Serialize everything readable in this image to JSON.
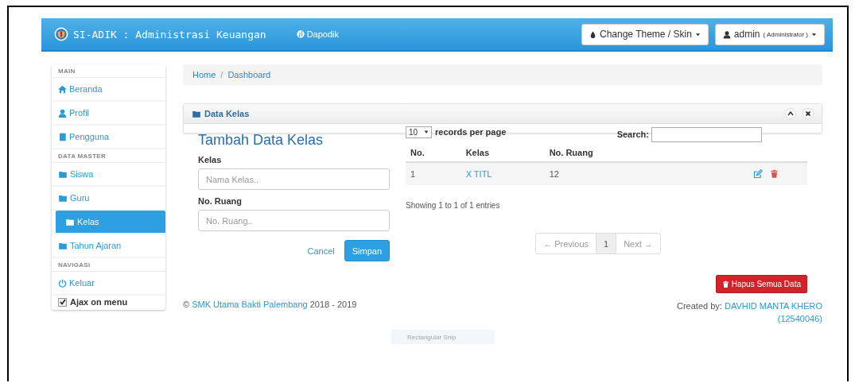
{
  "navbar": {
    "brand": "SI-ADIK : Administrasi Keuangan",
    "link": "Dapodik",
    "theme_button": "Change Theme / Skin",
    "user_button": {
      "name": "admin",
      "role": "( Administrator )"
    }
  },
  "sidebar": {
    "items": [
      {
        "kind": "header",
        "label": "MAIN"
      },
      {
        "kind": "link",
        "label": "Beranda",
        "selected": false
      },
      {
        "kind": "link",
        "label": "Profil",
        "selected": false
      },
      {
        "kind": "link",
        "label": "Pengguna",
        "selected": false
      },
      {
        "kind": "header",
        "label": "DATA MASTER"
      },
      {
        "kind": "link",
        "label": "Siswa",
        "selected": false
      },
      {
        "kind": "link",
        "label": "Guru",
        "selected": false
      },
      {
        "kind": "link",
        "label": "Kelas",
        "selected": true
      },
      {
        "kind": "link",
        "label": "Tahun Ajaran",
        "selected": false
      },
      {
        "kind": "header",
        "label": "NAVIGASI"
      },
      {
        "kind": "link",
        "label": "Keluar",
        "selected": false
      },
      {
        "kind": "checkbox",
        "label": "Ajax on menu",
        "checked": true
      }
    ]
  },
  "breadcrumb": {
    "items": [
      "Home",
      "Dashboard"
    ],
    "separator": "/"
  },
  "panel": {
    "title": "Data Kelas"
  },
  "form": {
    "title": "Tambah Data Kelas",
    "fields": [
      {
        "label": "Kelas",
        "placeholder": "Nama Kelas.."
      },
      {
        "label": "No. Ruang",
        "placeholder": "No. Ruang.."
      }
    ],
    "cancel": "Cancel",
    "submit": "Simpan"
  },
  "table": {
    "page_size": "10",
    "page_size_label": "records per page",
    "search_label": "Search:",
    "columns": [
      "No.",
      "Kelas",
      "No. Ruang"
    ],
    "rows": [
      {
        "no": "1",
        "kelas": "X TITL",
        "ruang": "12"
      }
    ],
    "info": "Showing 1 to 1 of 1 entries",
    "pagination": [
      {
        "label": "← Previous",
        "selected": false
      },
      {
        "label": "1",
        "selected": true
      },
      {
        "label": "Next →",
        "selected": false
      }
    ],
    "delete_all": "Hapus Semua Data"
  },
  "footer": {
    "copyright_sign": "©",
    "school": "SMK Utama Bakti Palembang",
    "years": "2018 - 2019",
    "credit_label": "Created by:",
    "author": "DAVHID MANTA KHERO",
    "author_id": "(12540046)"
  },
  "snip_overlay": "Rectangular Snip"
}
